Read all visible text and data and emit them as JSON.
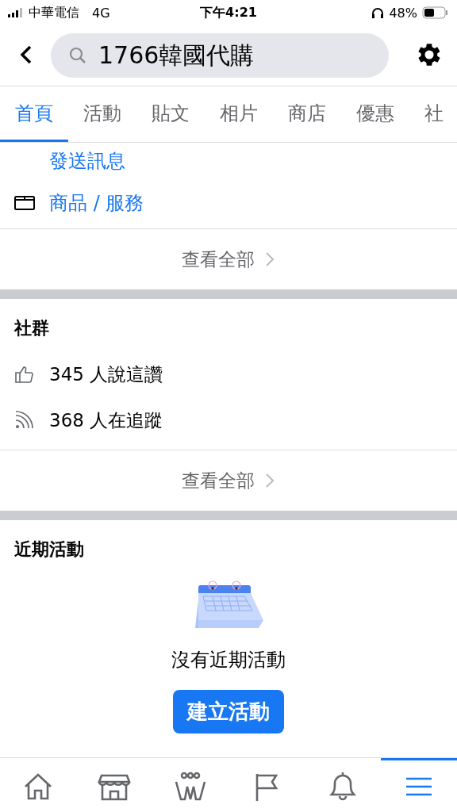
{
  "status_bar": {
    "carrier": "中華電信",
    "network": "4G",
    "time": "下午4:21",
    "battery": "48%"
  },
  "search": {
    "value": "1766韓國代購"
  },
  "tabs": [
    {
      "label": "首頁",
      "selected": true
    },
    {
      "label": "活動",
      "selected": false
    },
    {
      "label": "貼文",
      "selected": false
    },
    {
      "label": "相片",
      "selected": false
    },
    {
      "label": "商店",
      "selected": false
    },
    {
      "label": "優惠",
      "selected": false
    },
    {
      "label": "社",
      "selected": false
    }
  ],
  "about": {
    "message_link": "發送訊息",
    "items": [
      {
        "kind": "products",
        "label": "商品 / 服務"
      }
    ],
    "see_all": "查看全部"
  },
  "community": {
    "title": "社群",
    "items": [
      {
        "kind": "likes",
        "label": "345 人說這讚"
      },
      {
        "kind": "follows",
        "label": "368 人在追蹤"
      }
    ],
    "see_all": "查看全部"
  },
  "events": {
    "title": "近期活動",
    "empty": "沒有近期活動",
    "button": "建立活動"
  },
  "nav": [
    {
      "kind": "home",
      "selected": false
    },
    {
      "kind": "shop",
      "selected": false
    },
    {
      "kind": "groups",
      "selected": false
    },
    {
      "kind": "pages",
      "selected": false
    },
    {
      "kind": "bell",
      "selected": false
    },
    {
      "kind": "menu",
      "selected": true
    }
  ]
}
